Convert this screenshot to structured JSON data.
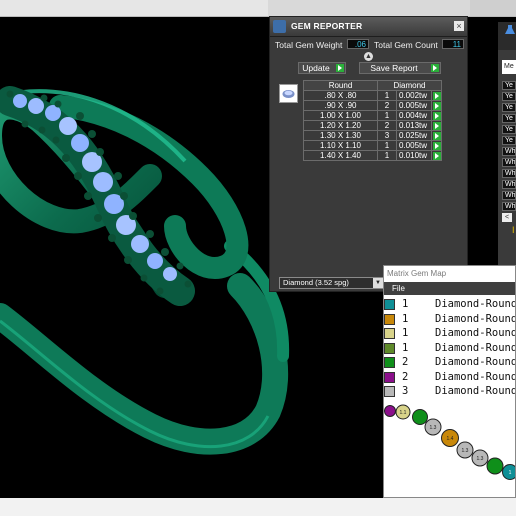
{
  "gem_reporter": {
    "title": "GEM REPORTER",
    "close_glyph": "×",
    "total_weight_label": "Total Gem Weight",
    "total_weight_value": ".06",
    "total_count_label": "Total Gem Count",
    "total_count_value": "11",
    "update_label": "Update",
    "save_label": "Save Report",
    "collapse_glyph": "▲",
    "table": {
      "headers": [
        "Round",
        "Diamond"
      ],
      "rows": [
        {
          "size": ".80 X .80",
          "count": "1",
          "weight": "0.002tw"
        },
        {
          "size": ".90 X .90",
          "count": "2",
          "weight": "0.005tw"
        },
        {
          "size": "1.00 X 1.00",
          "count": "1",
          "weight": "0.004tw"
        },
        {
          "size": "1.20 X 1.20",
          "count": "2",
          "weight": "0.013tw"
        },
        {
          "size": "1.30 X 1.30",
          "count": "3",
          "weight": "0.025tw"
        },
        {
          "size": "1.10 X 1.10",
          "count": "1",
          "weight": "0.005tw"
        },
        {
          "size": "1.40 X 1.40",
          "count": "1",
          "weight": "0.010tw"
        }
      ]
    },
    "gem_select": "Diamond     (3.52 spg)",
    "select_arrow": "▼"
  },
  "side_panel": {
    "field_text": "Me",
    "items": [
      "Ye",
      "Ye",
      "Ye",
      "Ye",
      "Ye",
      "Ye",
      "Wh",
      "Wh",
      "Wh",
      "Wh",
      "Wh",
      "Wh"
    ],
    "scroll_glyph": "<",
    "bottom_glyph": "I"
  },
  "gem_map": {
    "title": "Matrix Gem Map",
    "menu_file": "File",
    "rows": [
      {
        "color": "#0f8f96",
        "count": "1",
        "name": "Diamond-Round"
      },
      {
        "color": "#c8880a",
        "count": "1",
        "name": "Diamond-Round"
      },
      {
        "color": "#d8d38a",
        "count": "1",
        "name": "Diamond-Round"
      },
      {
        "color": "#5f8a2a",
        "count": "1",
        "name": "Diamond-Round"
      },
      {
        "color": "#0f8f1a",
        "count": "2",
        "name": "Diamond-Round"
      },
      {
        "color": "#8b0f8b",
        "count": "2",
        "name": "Diamond-Round"
      },
      {
        "color": "#b8b8b8",
        "count": "3",
        "name": "Diamond-Round"
      }
    ],
    "chain_labels": [
      "1.1",
      "1.3",
      "1.4",
      "1.3",
      "1.3",
      "1"
    ]
  }
}
